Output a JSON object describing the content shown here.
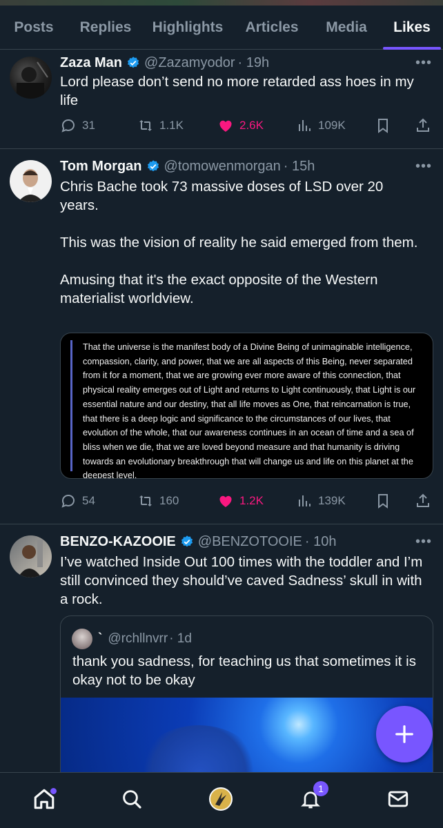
{
  "tabs": [
    {
      "label": "Posts"
    },
    {
      "label": "Replies"
    },
    {
      "label": "Highlights"
    },
    {
      "label": "Articles"
    },
    {
      "label": "Media"
    },
    {
      "label": "Likes"
    }
  ],
  "active_tab": "Likes",
  "accent_color": "#7856ff",
  "like_color": "#f91880",
  "posts": [
    {
      "name": "Zaza Man",
      "handle": "@Zazamyodor",
      "time": "· 19h",
      "text": "Lord please don’t send no more retarded ass hoes in my life",
      "replies": "31",
      "reposts": "1.1K",
      "likes": "2.6K",
      "views": "109K"
    },
    {
      "name": "Tom Morgan",
      "handle": "@tomowenmorgan",
      "time": "· 15h",
      "paragraphs": [
        "Chris Bache took 73 massive doses of LSD over 20 years.",
        "This was the vision of reality he said emerged from them.",
        "Amusing that it's the exact opposite of the Western materialist worldview."
      ],
      "image_text": "That the universe is the manifest body of a Divine Being of unimaginable intelligence, compassion, clarity, and power, that we are all aspects of this Being, never separated from it for a moment, that we are growing ever more aware of this connection, that physical reality emerges out of Light and returns to Light continuously, that Light is our essential nature and our destiny, that all life moves as One, that reincarnation is true, that there is a deep logic and significance to the circumstances of our lives, that evolution of the whole, that our awareness continues in an ocean of time and a sea of bliss when we die, that we are loved beyond measure and that humanity is driving towards an evolutionary breakthrough that will change us and life on this planet at the deepest level.",
      "replies": "54",
      "reposts": "160",
      "likes": "1.2K",
      "views": "139K"
    },
    {
      "name": "BENZO-KAZOOIE",
      "handle": "@BENZOTOOIE",
      "time": "· 10h",
      "text": "I’ve watched Inside Out 100 times with the toddler and I’m still convinced they should’ve caved Sadness’ skull in with a rock.",
      "quote": {
        "name": "`",
        "handle": "@rchllnvrr",
        "time": "· 1d",
        "text": "thank you sadness, for teaching us that sometimes it is okay not to be okay"
      }
    }
  ],
  "notifications_badge": "1",
  "icons": [
    "more-icon",
    "reply-icon",
    "repost-icon",
    "like-icon",
    "views-icon",
    "bookmark-icon",
    "share-icon",
    "verified-icon",
    "home-icon",
    "search-icon",
    "grok-icon",
    "bell-icon",
    "mail-icon",
    "compose-plus-icon"
  ]
}
